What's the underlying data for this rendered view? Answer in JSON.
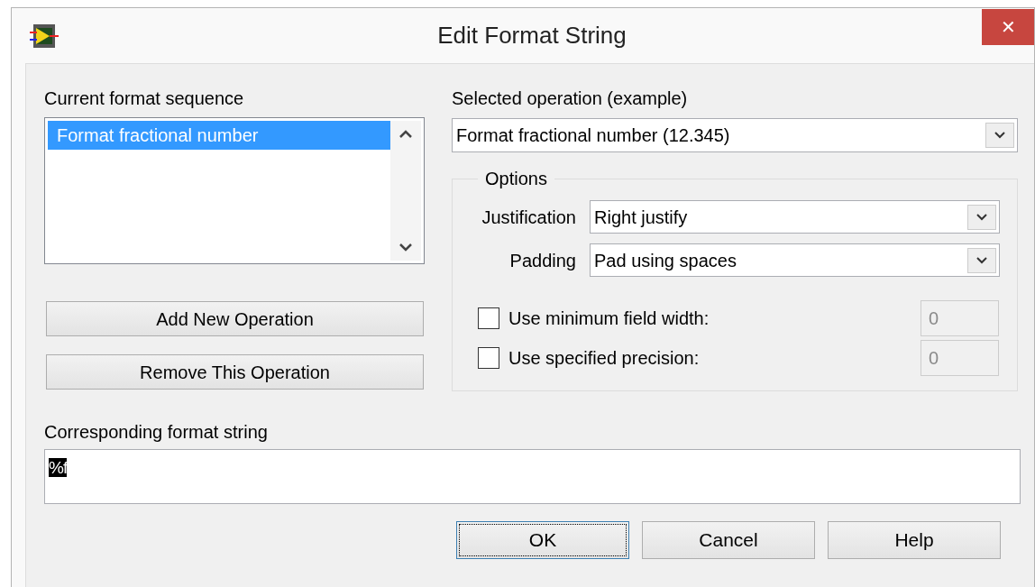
{
  "window": {
    "title": "Edit Format String",
    "close": "✕"
  },
  "sequence": {
    "label": "Current format sequence",
    "items": [
      {
        "text": "Format fractional number",
        "selected": true
      }
    ]
  },
  "sequence_buttons": [
    "Add New Operation",
    "Remove This Operation"
  ],
  "operation": {
    "label": "Selected operation (example)",
    "value": "Format fractional number (12.345)"
  },
  "options": {
    "title": "Options",
    "selects": [
      {
        "label": "Justification",
        "value": "Right justify"
      },
      {
        "label": "Padding",
        "value": "Pad using spaces"
      }
    ],
    "checks": [
      {
        "label": "Use minimum field width:",
        "checked": false,
        "value": "0",
        "disabled": true
      },
      {
        "label": "Use specified precision:",
        "checked": false,
        "value": "0",
        "disabled": true
      }
    ]
  },
  "format_string": {
    "label": "Corresponding format string",
    "value": "%f",
    "selected": true
  },
  "buttons": [
    {
      "label": "OK",
      "focused": true
    },
    {
      "label": "Cancel",
      "focused": false
    },
    {
      "label": "Help",
      "focused": false
    }
  ]
}
